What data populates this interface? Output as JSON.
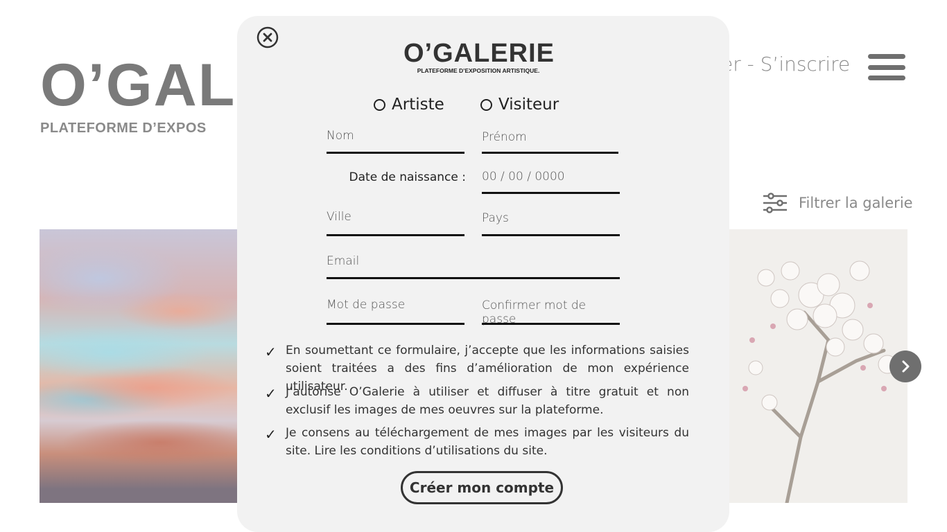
{
  "background": {
    "logo_title": "O’GAL",
    "tagline": "PLATEFORME D’EXPOS",
    "auth_links": "er - S’inscrire",
    "filter_label": "Filtrer la galerie"
  },
  "modal": {
    "logo_title": "O’GALERIE",
    "logo_tagline": "PLATEFORME D’EXPOSITION ARTISTIQUE.",
    "role_options": [
      "Artiste",
      "Visiteur"
    ],
    "fields": {
      "last_name": "Nom",
      "first_name": "Prénom",
      "birthdate_label": "Date de naissance :",
      "birthdate_placeholder": "00 / 00 / 0000",
      "city": "Ville",
      "country": "Pays",
      "email": "Email",
      "password": "Mot de passe",
      "confirm_password": "Confirmer mot de passe"
    },
    "consents": [
      "En soumettant ce formulaire, j’accepte que les informations saisies soient traitées a des fins d’amélioration de mon expérience utilisateur.",
      "J’autorise O’Galerie à utiliser et diffuser à titre gratuit et non exclusif les images de mes oeuvres sur la plateforme.",
      "Je consens au téléchargement de mes images par les visiteurs du site. Lire les conditions d’utilisations du site."
    ],
    "submit_label": "Créer mon compte"
  },
  "icons": {
    "close": "close-circle-icon",
    "menu": "hamburger-menu-icon",
    "filter": "sliders-filter-icon",
    "next": "chevron-right-icon",
    "check": "checkmark-icon"
  }
}
